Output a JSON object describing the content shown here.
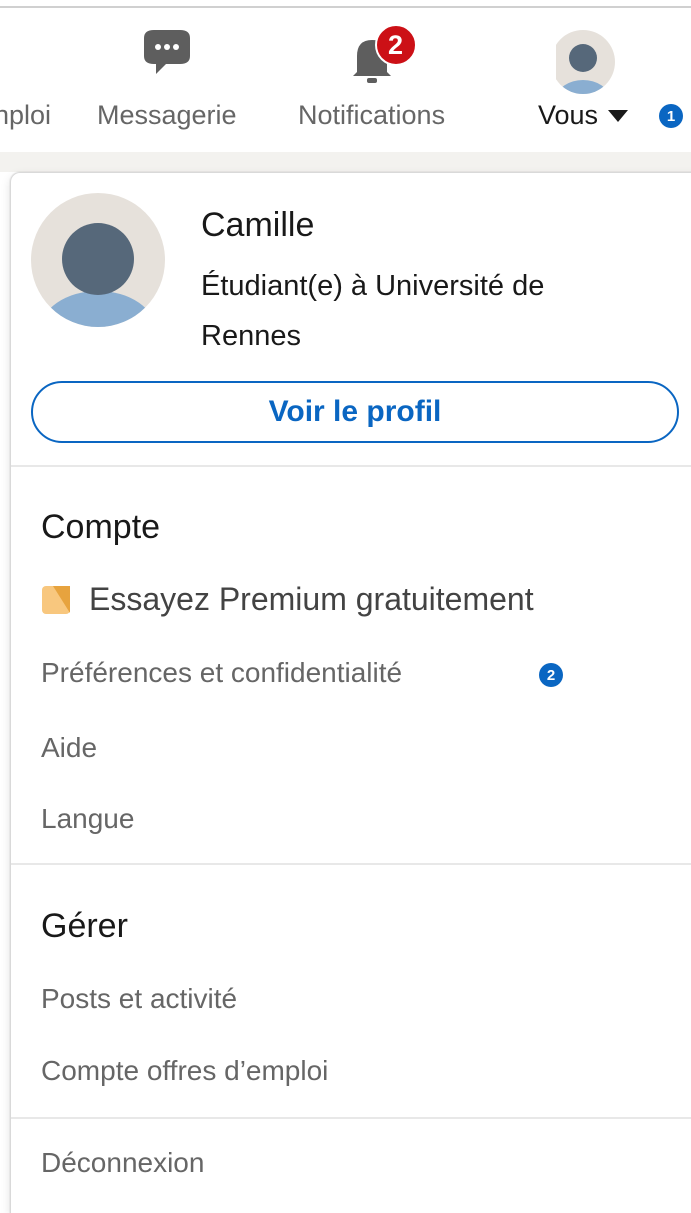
{
  "nav": {
    "items": [
      {
        "label": "nploi",
        "icon": "briefcase-icon"
      },
      {
        "label": "Messagerie",
        "icon": "chat-bubble-icon"
      },
      {
        "label": "Notifications",
        "icon": "bell-icon",
        "badge": "2"
      },
      {
        "label": "Vous",
        "icon": "avatar"
      }
    ],
    "vous_step_badge": "1"
  },
  "profile": {
    "name": "Camille",
    "headline": "Étudiant(e) à Université de Rennes",
    "view_profile_label": "Voir le profil"
  },
  "account": {
    "title": "Compte",
    "premium_label": "Essayez Premium gratuitement",
    "preferences_label": "Préférences et confidentialité",
    "preferences_step_badge": "2",
    "help_label": "Aide",
    "language_label": "Langue"
  },
  "manage": {
    "title": "Gérer",
    "posts_label": "Posts et activité",
    "jobs_account_label": "Compte offres d’emploi"
  },
  "signout_label": "Déconnexion",
  "colors": {
    "accent": "#0a66c2",
    "notification_badge": "#cc1016",
    "premium": "#e7a33e",
    "muted_text": "#666666"
  }
}
